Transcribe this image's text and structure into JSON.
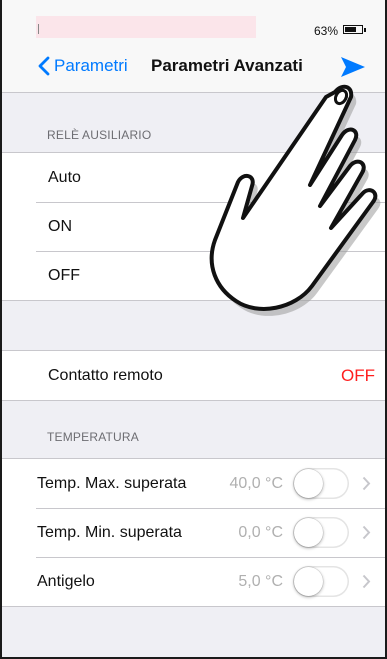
{
  "status_bar": {
    "battery_percent": "63%"
  },
  "nav": {
    "back_label": "Parametri",
    "title": "Parametri Avanzati"
  },
  "rele": {
    "header": "RELÈ AUSILIARIO",
    "options": [
      "Auto",
      "ON",
      "OFF"
    ]
  },
  "contatto": {
    "label": "Contatto remoto",
    "value": "OFF",
    "value_color": "#ff1e1e"
  },
  "temperatura": {
    "header": "TEMPERATURA",
    "rows": [
      {
        "label": "Temp. Max. superata",
        "value": "40,0 °C",
        "enabled": false
      },
      {
        "label": "Temp. Min. superata",
        "value": "0,0 °C",
        "enabled": false
      },
      {
        "label": "Antigelo",
        "value": "5,0 °C",
        "enabled": false
      }
    ]
  },
  "colors": {
    "accent": "#007aff",
    "background": "#efeff4",
    "off_red": "#ff1e1e"
  },
  "icons": [
    "chevron-left-icon",
    "send-icon",
    "chevron-right-icon",
    "hand-pointer-icon"
  ]
}
